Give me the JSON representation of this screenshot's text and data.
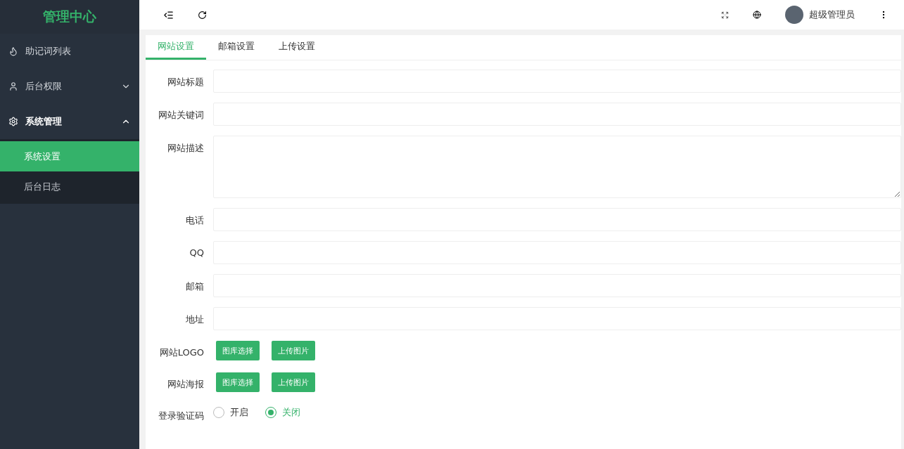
{
  "sidebar": {
    "logo": "管理中心",
    "items": [
      {
        "label": "助记词列表"
      },
      {
        "label": "后台权限",
        "expanded": false
      },
      {
        "label": "系统管理",
        "expanded": true,
        "children": [
          {
            "label": "系统设置",
            "selected": true
          },
          {
            "label": "后台日志",
            "selected": false
          }
        ]
      }
    ]
  },
  "header": {
    "user": "超级管理员"
  },
  "tabs": [
    {
      "label": "网站设置",
      "selected": true
    },
    {
      "label": "邮箱设置",
      "selected": false
    },
    {
      "label": "上传设置",
      "selected": false
    }
  ],
  "form": {
    "rows": [
      {
        "kind": "input",
        "label": "网站标题"
      },
      {
        "kind": "input",
        "label": "网站关键词"
      },
      {
        "kind": "textarea",
        "label": "网站描述"
      },
      {
        "kind": "input",
        "label": "电话"
      },
      {
        "kind": "input",
        "label": "QQ"
      },
      {
        "kind": "input",
        "label": "邮箱"
      },
      {
        "kind": "input",
        "label": "地址"
      },
      {
        "kind": "buttons",
        "label": "网站LOGO",
        "buttons": [
          "图库选择",
          "上传图片"
        ]
      },
      {
        "kind": "buttons",
        "label": "网站海报",
        "buttons": [
          "图库选择",
          "上传图片"
        ]
      },
      {
        "kind": "radio",
        "label": "登录验证码",
        "options": [
          {
            "label": "开启",
            "selected": false
          },
          {
            "label": "关闭",
            "selected": true
          }
        ]
      }
    ]
  }
}
